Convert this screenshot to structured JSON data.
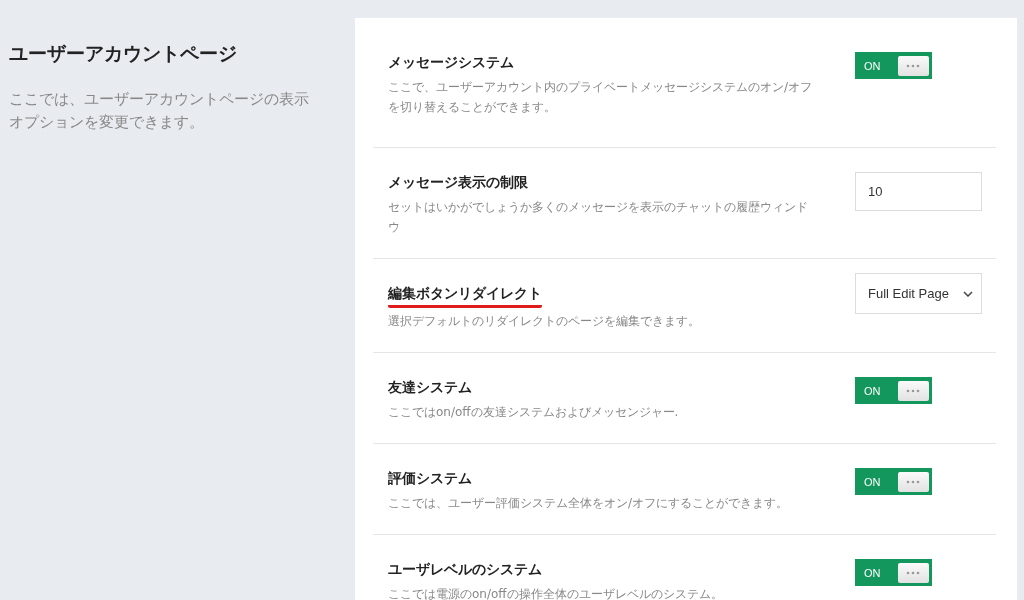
{
  "section": {
    "title": "ユーザーアカウントページ",
    "description": "ここでは、ユーザーアカウントページの表示オプションを変更できます。"
  },
  "settings": [
    {
      "kind": "toggle",
      "title": "メッセージシステム",
      "description": "ここで、ユーザーアカウント内のプライベートメッセージシステムのオン/オフを切り替えることができます。",
      "label": "ON",
      "on": true,
      "underlined": false
    },
    {
      "kind": "number",
      "title": "メッセージ表示の制限",
      "description": "セットはいかがでしょうか多くのメッセージを表示のチャットの履歴ウィンドウ",
      "value": "10",
      "underlined": false
    },
    {
      "kind": "select",
      "title": "編集ボタンリダイレクト",
      "description": "選択デフォルトのリダイレクトのページを編集できます。",
      "value": "Full Edit Page",
      "underlined": true
    },
    {
      "kind": "toggle",
      "title": "友達システム",
      "description": "ここではon/offの友達システムおよびメッセンジャー.",
      "label": "ON",
      "on": true,
      "underlined": false
    },
    {
      "kind": "toggle",
      "title": "評価システム",
      "description": "ここでは、ユーザー評価システム全体をオン/オフにすることができます。",
      "label": "ON",
      "on": true,
      "underlined": false
    },
    {
      "kind": "toggle",
      "title": "ユーザレベルのシステム",
      "description": "ここでは電源のon/offの操作全体のユーザレベルのシステム。",
      "label": "ON",
      "on": true,
      "underlined": false
    }
  ]
}
